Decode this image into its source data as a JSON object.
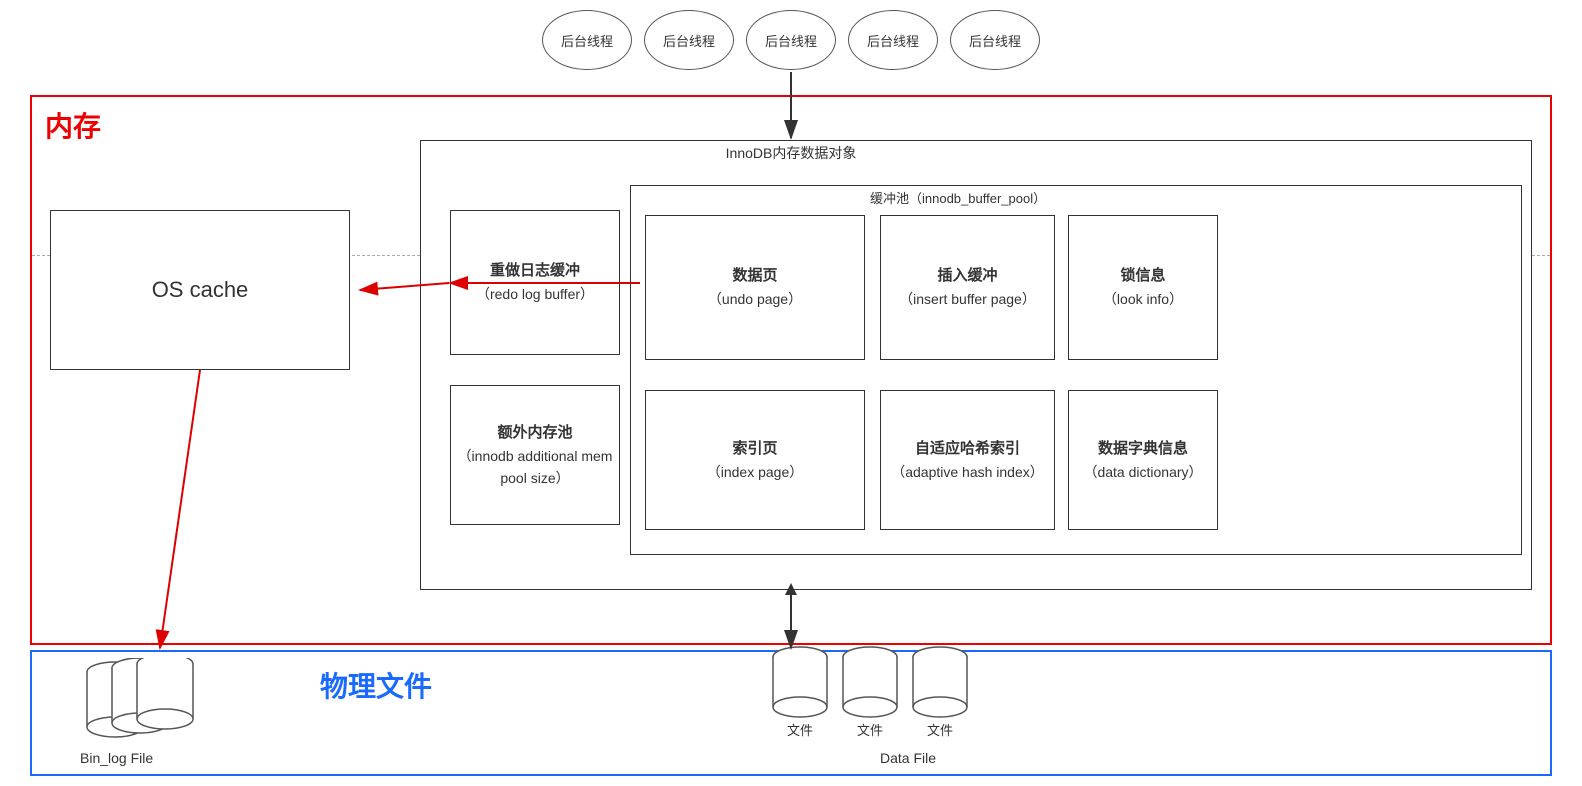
{
  "threads": {
    "items": [
      "后台线程",
      "后台线程",
      "后台线程",
      "后台线程",
      "后台线程"
    ]
  },
  "memory": {
    "label": "内存",
    "innodb_title": "InnoDB内存数据对象",
    "buffer_pool_title": "缓冲池（innodb_buffer_pool）",
    "redo_log": {
      "line1": "重做日志缓冲",
      "line2": "（redo log buffer）"
    },
    "add_mem": {
      "line1": "额外内存池",
      "line2": "（innodb additional mem",
      "line3": "pool size）"
    },
    "data_page": {
      "line1": "数据页",
      "line2": "（undo page）"
    },
    "insert_buf": {
      "line1": "插入缓冲",
      "line2": "（insert buffer page）"
    },
    "lock_info": {
      "line1": "锁信息",
      "line2": "（look info）"
    },
    "index_page": {
      "line1": "索引页",
      "line2": "（index page）"
    },
    "hash_index": {
      "line1": "自适应哈希索引",
      "line2": "（adaptive hash index）"
    },
    "data_dict": {
      "line1": "数据字典信息",
      "line2": "（data dictionary）"
    },
    "os_cache": "OS  cache"
  },
  "physical": {
    "label": "物理文件",
    "binlog_label": "Bin_log File",
    "datafile_label": "Data File",
    "file_labels": [
      "文件",
      "文件",
      "文件"
    ]
  },
  "colors": {
    "red": "#dd0000",
    "blue": "#1a6aff",
    "dark": "#333333",
    "border": "#555555"
  }
}
